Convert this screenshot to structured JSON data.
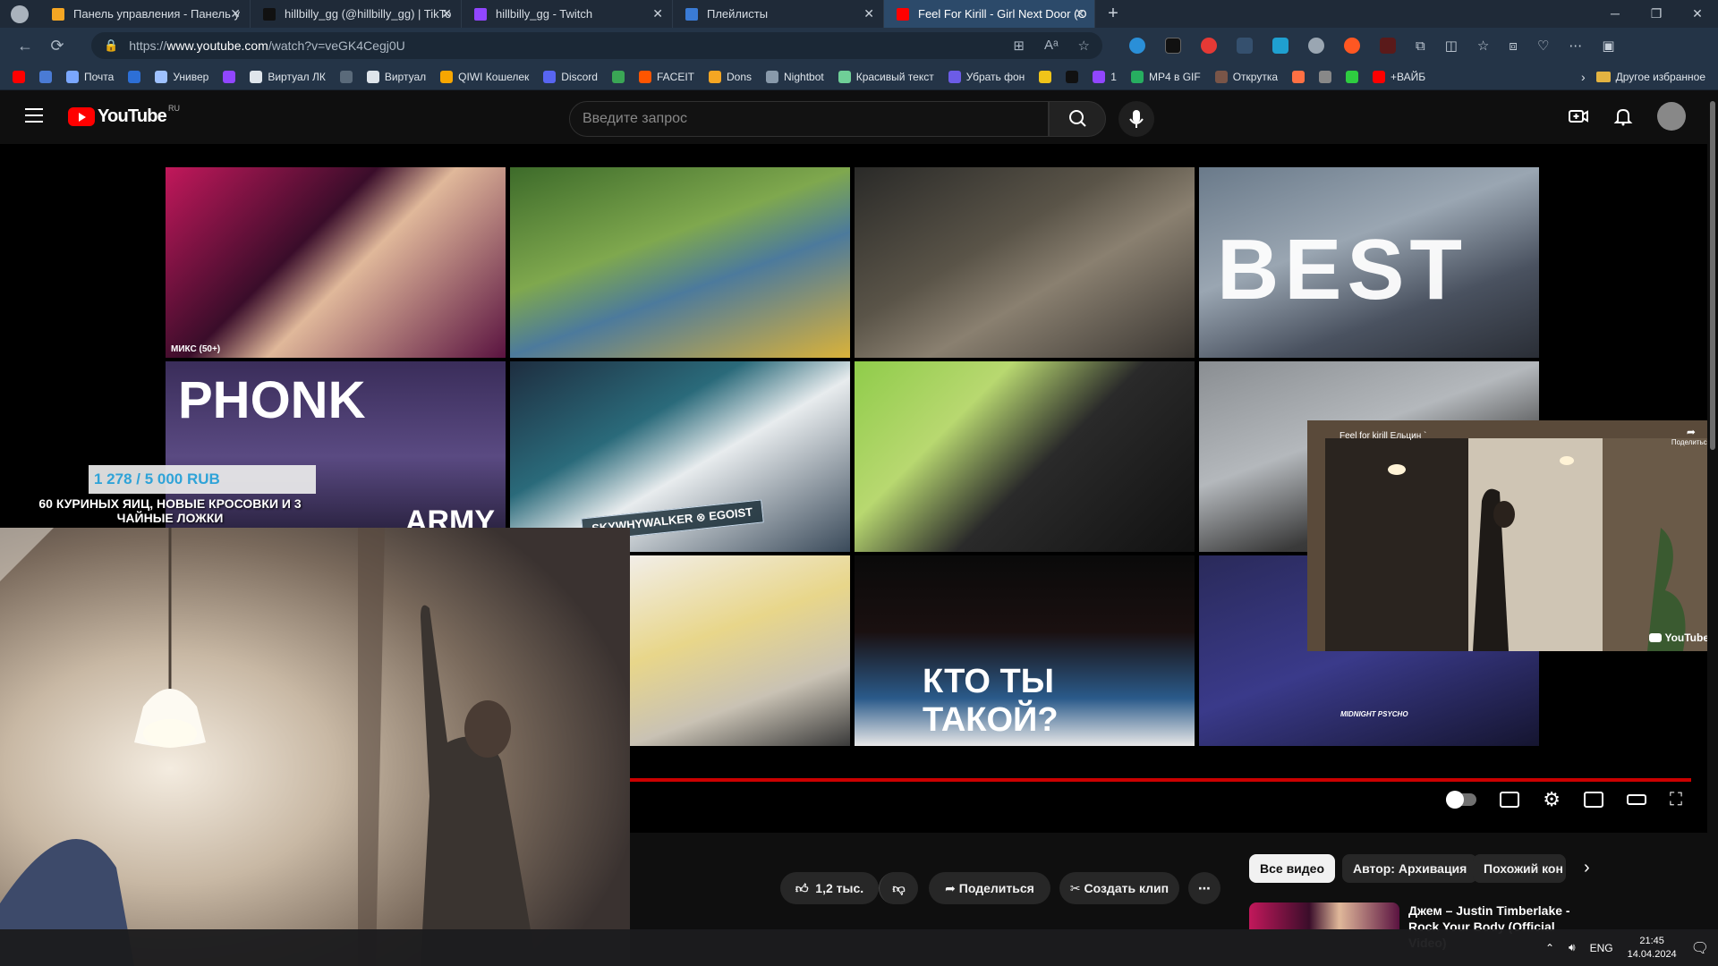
{
  "browser": {
    "tabs": [
      {
        "title": "Панель управления - Панель у",
        "color": "#f5a623",
        "active": false
      },
      {
        "title": "hillbilly_gg (@hillbilly_gg) | TikTo",
        "color": "#111111",
        "active": false
      },
      {
        "title": "hillbilly_gg - Twitch",
        "color": "#9146ff",
        "active": false
      },
      {
        "title": "Плейлисты",
        "color": "#3a7bd5",
        "active": false
      },
      {
        "title": "Feel For Kirill - Girl Next Door (O",
        "color": "#ff0000",
        "active": true
      }
    ],
    "url_prefix": "https://",
    "url_host": "www.youtube.com",
    "url_path": "/watch?v=veGK4Cegj0U",
    "bookmarks": [
      {
        "label": "",
        "color": "#ff0000"
      },
      {
        "label": "",
        "color": "#4a7bd5"
      },
      {
        "label": "Почта",
        "color": "#7aa7ff"
      },
      {
        "label": "",
        "color": "#2d6fd6"
      },
      {
        "label": "Универ",
        "color": "#9ec1ff"
      },
      {
        "label": "",
        "color": "#9146ff"
      },
      {
        "label": "Виртуал ЛК",
        "color": "#dfe5eb"
      },
      {
        "label": "",
        "color": "#5a6a7a"
      },
      {
        "label": "Виртуал",
        "color": "#dfe5eb"
      },
      {
        "label": "QIWI Кошелек",
        "color": "#f7a600"
      },
      {
        "label": "Discord",
        "color": "#5865f2"
      },
      {
        "label": "",
        "color": "#3aa655"
      },
      {
        "label": "FACEIT",
        "color": "#ff5500"
      },
      {
        "label": "Dons",
        "color": "#f5a623"
      },
      {
        "label": "Nightbot",
        "color": "#8899aa"
      },
      {
        "label": "Красивый текст",
        "color": "#6fcf97"
      },
      {
        "label": "Убрать фон",
        "color": "#6c5ce7"
      },
      {
        "label": "",
        "color": "#f0c419"
      },
      {
        "label": "",
        "color": "#111111"
      },
      {
        "label": "1",
        "color": "#9146ff"
      },
      {
        "label": "MP4 в GIF",
        "color": "#27ae60"
      },
      {
        "label": "Открутка",
        "color": "#795548"
      },
      {
        "label": "",
        "color": "#ff7043"
      },
      {
        "label": "",
        "color": "#888888"
      },
      {
        "label": "",
        "color": "#2ecc40"
      },
      {
        "label": "+ВАЙБ",
        "color": "#ff0000"
      }
    ],
    "other_bookmarks": "Другое избранное"
  },
  "youtube": {
    "logo_text": "YouTube",
    "logo_region": "RU",
    "search_placeholder": "Введите запрос"
  },
  "grid": {
    "tiles": [
      {
        "caption": "",
        "badge": "МИКС (50+)",
        "bg": "linear-gradient(135deg,#c2185b 0%,#3a0d2a 40%,#e0b89a 55%,#5a1340 100%)"
      },
      {
        "caption": "",
        "badge": "",
        "bg": "linear-gradient(160deg,#3d6b2a 0%,#7fa84e 40%,#4c7a9c 60%,#d9b23a 100%)"
      },
      {
        "caption": "",
        "badge": "",
        "bg": "linear-gradient(150deg,#2a2a28 0%,#5a5448 40%,#8a8070 60%,#3a3632 100%)"
      },
      {
        "caption": "BEST",
        "badge": "",
        "bg": "linear-gradient(160deg,#6a7a8a 0%,#9aa6b2 40%,#4a5260 70%,#2a2e36 100%)"
      },
      {
        "caption": "PHONK",
        "caption2": "ARMY",
        "badge": "",
        "bg": "linear-gradient(180deg,#3a2d5a 0%,#5a4a82 50%,#1e1830 100%)"
      },
      {
        "caption": "SKYWHYWALKER ⊗ EGOIST",
        "badge": "",
        "bg": "linear-gradient(150deg,#1e2e40 0%,#2a6a7a 35%,#e8ecee 55%,#3a4a5a 100%)"
      },
      {
        "caption": "",
        "badge": "",
        "bg": "linear-gradient(135deg,#8fcc4a 0%,#b8d870 30%,#2a2a2a 55%,#111 100%)"
      },
      {
        "caption": "",
        "badge": "",
        "bg": "linear-gradient(160deg,#8a8e92 0%,#b4b8bc 40%,#3a3a3a 70%,#222 100%)"
      },
      {
        "caption": "",
        "badge": "",
        "bg": "linear-gradient(160deg,#f2eee8 0%,#e8d68a 40%,#c9c2b4 70%,#3a3a3a 100%)"
      },
      {
        "caption": "КТО ТЫ ТАКОЙ?",
        "badge": "",
        "bg": "linear-gradient(180deg,#0a0a0a 0%,#1a1010 40%,#2a5a8a 75%,#e8e8e8 100%)"
      },
      {
        "caption": "MIDNIGHT PSYCHO",
        "badge": "",
        "bg": "linear-gradient(160deg,#2a2a5a 0%,#3a3a8a 50%,#151530 100%)"
      }
    ]
  },
  "stream_overlay": {
    "donation_amount": "1 278 / 5 000 RUB",
    "donation_message": "60 КУРИНЫХ ЯИЦ, НОВЫЕ КРОСОВКИ И 3 ЧАЙНЫЕ ЛОЖКИ"
  },
  "miniplayer": {
    "title": "Feel for kirill Ельцин `",
    "share_label": "Поделиться",
    "brand": "YouTube"
  },
  "actions": {
    "likes": "1,2 тыс.",
    "share": "Поделиться",
    "clip": "Создать клип",
    "more": "⋯"
  },
  "chips": [
    "Все видео",
    "Автор: Архивация",
    "Похожий кон"
  ],
  "recommendation": {
    "title_line1": "Джем – Justin Timberlake -",
    "title_line2": "Rock Your Body (Official Video)"
  },
  "taskbar": {
    "lang": "ENG",
    "time": "21:45",
    "date": "14.04.2024"
  }
}
